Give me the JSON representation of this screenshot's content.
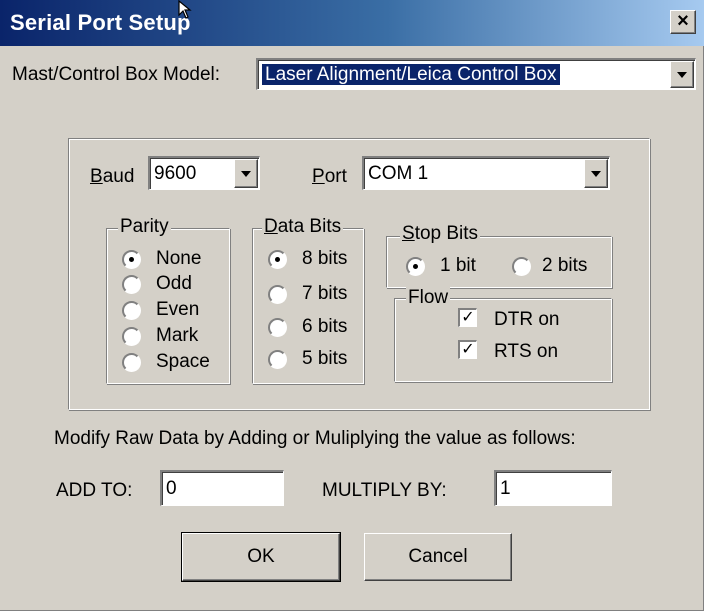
{
  "window": {
    "title": "Serial Port Setup",
    "close_glyph": "×"
  },
  "model": {
    "label": "Mast/Control Box Model:",
    "value": "Laser Alignment/Leica Control Box"
  },
  "comm": {
    "baud_label_underlined": "B",
    "baud_label_rest": "aud",
    "baud_value": "9600",
    "port_label_underlined": "P",
    "port_label_rest": "ort",
    "port_value": "COM 1"
  },
  "parity": {
    "title": "Parity",
    "options": [
      {
        "label": "None",
        "selected": true
      },
      {
        "label": "Odd",
        "selected": false
      },
      {
        "label": "Even",
        "selected": false
      },
      {
        "label": "Mark",
        "selected": false
      },
      {
        "label": "Space",
        "selected": false
      }
    ]
  },
  "data_bits": {
    "title_underlined": "D",
    "title_rest": "ata Bits",
    "options": [
      {
        "label": "8 bits",
        "selected": true
      },
      {
        "label": "7 bits",
        "selected": false
      },
      {
        "label": "6 bits",
        "selected": false
      },
      {
        "label": "5 bits",
        "selected": false
      }
    ]
  },
  "stop_bits": {
    "title_underlined": "S",
    "title_rest": "top Bits",
    "options": [
      {
        "label": "1 bit",
        "selected": true
      },
      {
        "label": "2 bits",
        "selected": false
      }
    ]
  },
  "flow": {
    "title": "Flow",
    "options": [
      {
        "label": "DTR on",
        "checked": true
      },
      {
        "label": "RTS on",
        "checked": true
      }
    ],
    "check_glyph": "✓"
  },
  "modify": {
    "instruction": "Modify Raw Data by Adding or Muliplying the value as follows:",
    "add_label": "ADD TO:",
    "add_value": "0",
    "multiply_label": "MULTIPLY BY:",
    "multiply_value": "1"
  },
  "buttons": {
    "ok": "OK",
    "cancel": "Cancel"
  },
  "colors": {
    "face": "#d4d0c8",
    "title_start": "#0a246a",
    "title_end": "#a6caf0",
    "selection": "#0a246a"
  }
}
